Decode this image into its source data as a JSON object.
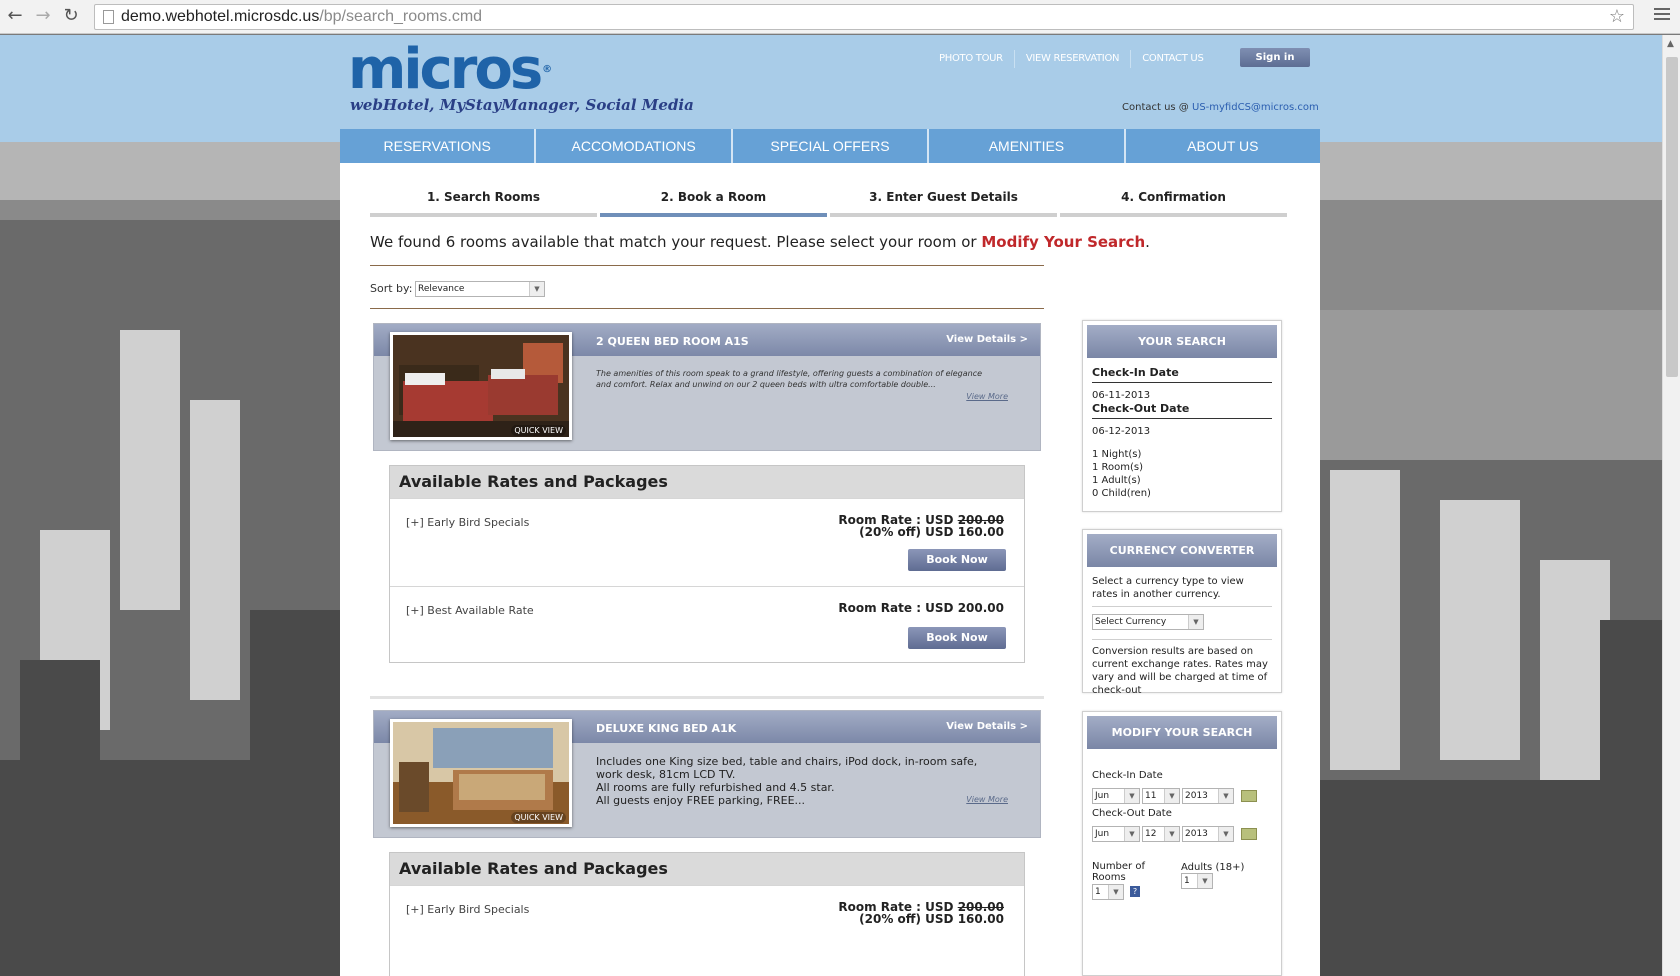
{
  "browser": {
    "url_host": "demo.webhotel.microsdc.us",
    "url_path": "/bp/search_rooms.cmd"
  },
  "header": {
    "logo_word": "micros",
    "logo_reg": "®",
    "tagline": "webHotel, MyStayManager, Social Media",
    "top_links": [
      "PHOTO TOUR",
      "VIEW RESERVATION",
      "CONTACT US"
    ],
    "signin_label": "Sign in",
    "contact_prefix": "Contact us @",
    "contact_email": "US-myfidCS@micros.com"
  },
  "nav": [
    "RESERVATIONS",
    "ACCOMODATIONS",
    "SPECIAL OFFERS",
    "AMENITIES",
    "ABOUT US"
  ],
  "steps": {
    "items": [
      "1. Search Rooms",
      "2. Book a Room",
      "3. Enter Guest Details",
      "4. Confirmation"
    ],
    "active_index": 1
  },
  "results": {
    "message": "We found 6 rooms available that match your request. Please select your room or",
    "modify_link": "Modify Your Search",
    "period": "."
  },
  "sort": {
    "label": "Sort by:",
    "value": "Relevance"
  },
  "rooms": [
    {
      "name": "2 QUEEN BED ROOM A1S",
      "view_details": "View Details >",
      "description": "The amenities of this room speak to a grand lifestyle, offering guests a combination of elegance and comfort. Relax and unwind on our 2 queen beds with ultra comfortable double...",
      "view_more": "View More",
      "quick_view": "QUICK VIEW",
      "rates_title": "Available Rates and Packages",
      "packages": [
        {
          "name": "[+] Early Bird Specials",
          "rate_label": "Room Rate : USD",
          "old_price": "200.00",
          "discount_label": "(20% off) USD 160.00",
          "book_label": "Book Now"
        },
        {
          "name": "[+] Best Available Rate",
          "rate_label": "Room Rate : USD 200.00",
          "book_label": "Book Now"
        }
      ]
    },
    {
      "name": "DELUXE KING BED A1K",
      "view_details": "View Details >",
      "description_lines": [
        "Includes one King size bed, table and chairs, iPod dock, in-room safe,",
        "work desk, 81cm LCD TV.",
        "All rooms are fully refurbished and 4.5 star.",
        "All guests enjoy FREE parking, FREE..."
      ],
      "view_more": "View More",
      "quick_view": "QUICK VIEW",
      "rates_title": "Available Rates and Packages",
      "packages": [
        {
          "name": "[+] Early Bird Specials",
          "rate_label": "Room Rate : USD",
          "old_price": "200.00",
          "discount_label": "(20% off) USD 160.00"
        }
      ]
    }
  ],
  "your_search": {
    "title": "YOUR SEARCH",
    "checkin_label": "Check-In Date",
    "checkin_value": "06-11-2013",
    "checkout_label": "Check-Out Date",
    "checkout_value": "06-12-2013",
    "nights": "1  Night(s)",
    "rooms": "1  Room(s)",
    "adults": "1  Adult(s)",
    "children": "0  Child(ren)"
  },
  "currency": {
    "title": "CURRENCY CONVERTER",
    "intro": "Select a currency type to view rates in another currency.",
    "select_placeholder": "Select Currency",
    "note": "Conversion results are based on current exchange rates. Rates may vary and will be charged at time of check-out"
  },
  "modify": {
    "title": "MODIFY YOUR SEARCH",
    "checkin_label": "Check-In Date",
    "checkin_month": "Jun",
    "checkin_day": "11",
    "checkin_year": "2013",
    "checkout_label": "Check-Out Date",
    "checkout_month": "Jun",
    "checkout_day": "12",
    "checkout_year": "2013",
    "rooms_label": "Number of Rooms",
    "rooms_value": "1",
    "adults_label": "Adults (18+)",
    "adults_value": "1",
    "help": "?"
  },
  "colors": {
    "header_bg": "#a9cce8",
    "nav_bg": "#66a1d6",
    "brand_blue": "#1f63a8",
    "link_red": "#c0282b",
    "card_header": "#7c88a8"
  }
}
